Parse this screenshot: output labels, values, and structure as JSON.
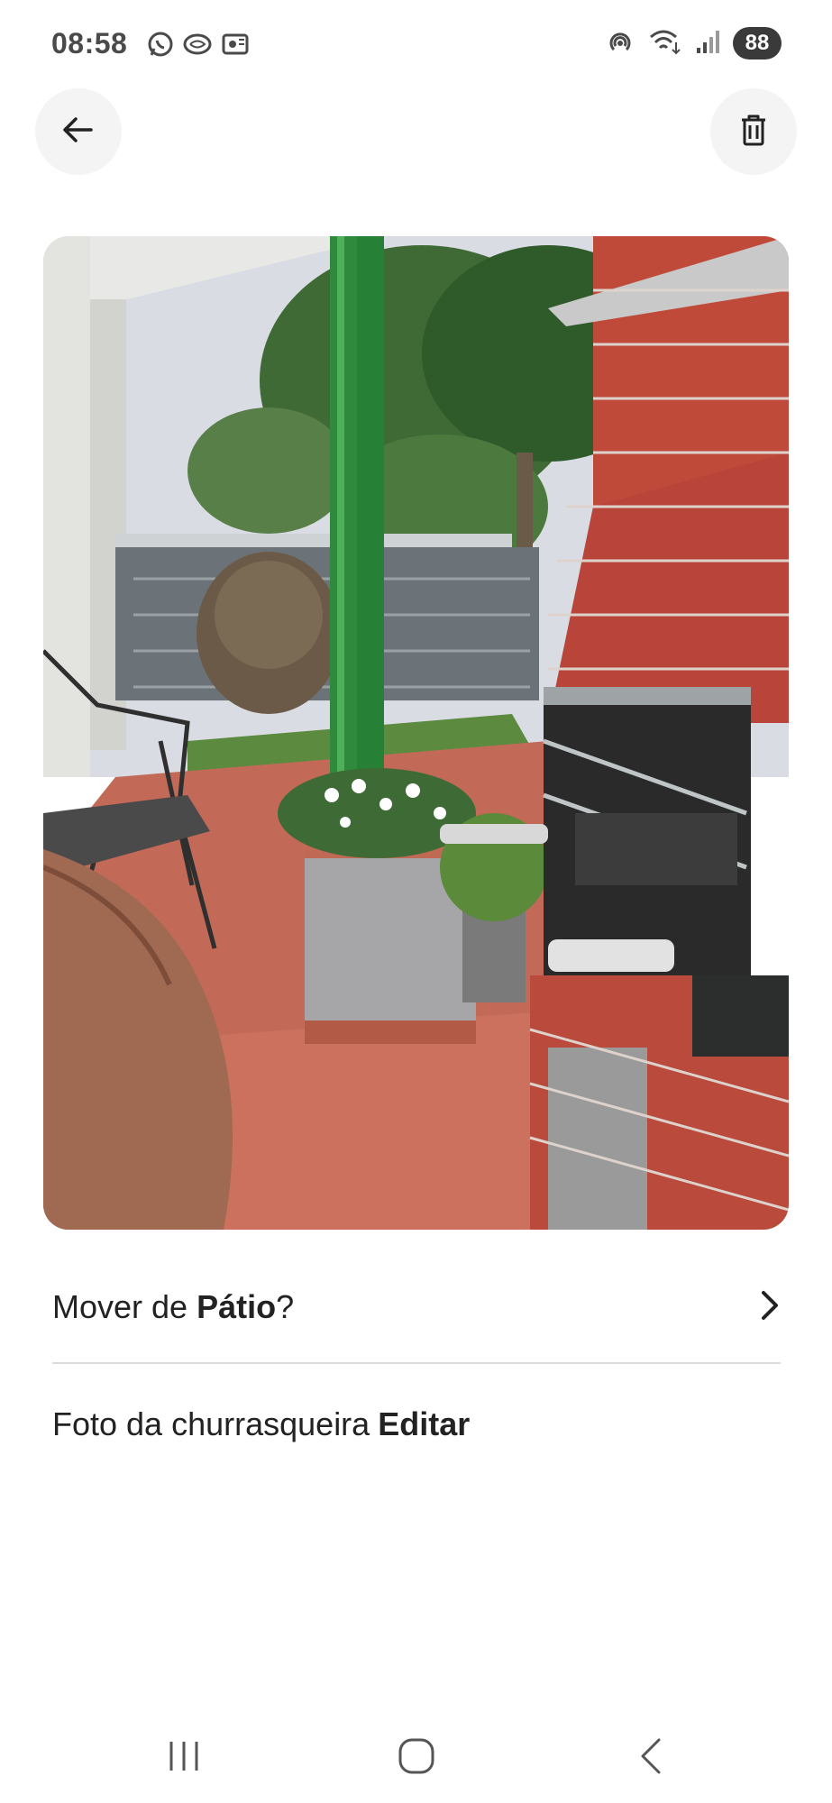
{
  "status_bar": {
    "time": "08:58",
    "battery": "88",
    "left_icons": [
      "whatsapp-icon",
      "message-icon",
      "photo-notification-icon"
    ],
    "right_icons": [
      "hotspot-icon",
      "wifi-icon",
      "signal-icon"
    ]
  },
  "header": {
    "back_icon": "arrow-left-icon",
    "delete_icon": "trash-icon"
  },
  "photo": {
    "subject": "churrasqueira"
  },
  "move_row": {
    "prefix": "Mover de ",
    "room": "Pátio",
    "suffix": "?",
    "icon": "chevron-right-icon"
  },
  "caption_row": {
    "caption": "Foto da churrasqueira",
    "edit_label": "Editar"
  },
  "nav_bar": {
    "items": [
      "recent-apps",
      "home",
      "back"
    ]
  },
  "colors": {
    "text": "#222222",
    "divider": "#dddddd",
    "button_bg": "#f4f4f4"
  }
}
